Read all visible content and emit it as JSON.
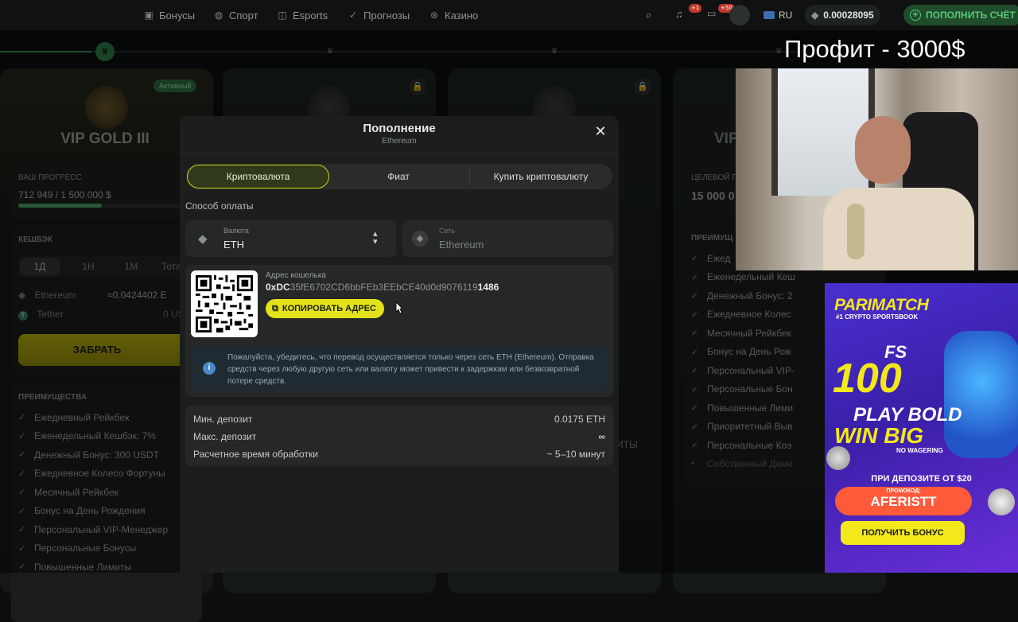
{
  "topbar": {
    "nav": [
      {
        "label": "Бонусы",
        "icon": "gift-icon"
      },
      {
        "label": "Спорт",
        "icon": "ball-icon"
      },
      {
        "label": "Esports",
        "icon": "gamepad-icon"
      },
      {
        "label": "Прогнозы",
        "icon": "check-circle-icon"
      },
      {
        "label": "Казино",
        "icon": "chip-icon"
      }
    ],
    "notif_badge": "+1",
    "chat_badge": "+50",
    "language": "RU",
    "balance": "0.00028095",
    "deposit_button": "ПОПОЛНИТЬ СЧЁТ"
  },
  "overlay": {
    "profit_text": "Профит - 3000$"
  },
  "vip_card": {
    "active_badge": "Активный",
    "title": "VIP GOLD III",
    "progress_label": "ВАШ ПРОГРЕСС",
    "progress_value": "712 949 / 1 500 000  $",
    "progress_fraction": 0.475,
    "cashback_label": "КЕШБЭК",
    "cashback_tabs": [
      "1Д",
      "1Н",
      "1М",
      "Тота"
    ],
    "coins": [
      {
        "name": "Ethereum",
        "value": "≈0.0424402 E"
      },
      {
        "name": "Tether",
        "value": "0 US"
      }
    ],
    "claim_button": "ЗАБРАТЬ",
    "benefits_label": "ПРЕИМУЩЕСТВА",
    "benefits": [
      "Ежедневный Рейкбек",
      "Еженедельный Кешбэк: 7%",
      "Денежный Бонус: 300 USDT",
      "Ежедневное Колесо Фортуны",
      "Месячный Рейкбек",
      "Бонус на День Рождения",
      "Персональный VIP-Менеджер",
      "Персональные Бонусы",
      "Повышенные Лимиты"
    ]
  },
  "card4": {
    "title": "VIP",
    "target_label": "ЦЕЛЕВОЙ П",
    "target_value": "15 000 0",
    "benefits_label": "ПРЕИМУЩ",
    "benefits": [
      "Ежед",
      "Еженедельный Кеш",
      "Денежный Бонус: 2",
      "Ежедневное Колес",
      "Месячный Рейкбек",
      "Бонус на День Рож",
      "Персональный VIP-",
      "Персональные Бон",
      "Повышенные Лими",
      "Приоритетный Выв",
      "Персональные Коэ",
      "Собственный Доме"
    ]
  },
  "card2_fragments": [
    "%",
    "Т",
    "ов",
    "ер"
  ],
  "card3_fragments": [
    "ИТЫ"
  ],
  "modal": {
    "title": "Пополнение",
    "subtitle": "Ethereum",
    "tabs": [
      "Криптовалюта",
      "Фиат",
      "Купить криптовалюту"
    ],
    "payment_method_label": "Способ оплаты",
    "currency_label": "Валюта",
    "currency_value": "ETH",
    "network_label": "Сеть",
    "network_value": "Ethereum",
    "wallet_label": "Адрес кошелька",
    "wallet_prefix": "0xDC",
    "wallet_middle": "35fE6702CD6bbFEb3EEbCE40d0d9076119",
    "wallet_suffix": "1486",
    "copy_button": "КОПИРОВАТЬ АДРЕС",
    "notice": "Пожалуйста, убедитесь, что перевод осуществляется только через сеть ETH (Ethereum). Отправка средств через любую другую сеть или валюту может привести к задержкам или безвозвратной потере средств.",
    "details": [
      {
        "label": "Мин. депозит",
        "value": "0.0175 ETH"
      },
      {
        "label": "Макс. депозит",
        "value": "∞"
      },
      {
        "label": "Расчетное время обработки",
        "value": "~ 5–10 минут"
      }
    ]
  },
  "ad": {
    "brand": "PARIMATCH",
    "tagline": "#1 CRYPTO SPORTSBOOK",
    "fs_label": "FS",
    "fs_number": "100",
    "headline1": "PLAY BOLD",
    "headline2": "WIN BIG",
    "no_wagering": "NO WAGERING",
    "min_deposit": "ПРИ ДЕПОЗИТЕ ОТ $20",
    "promo_label": "ПРОМОКОД:",
    "promo_code": "AFERISTT",
    "cta": "ПОЛУЧИТЬ БОНУС"
  }
}
